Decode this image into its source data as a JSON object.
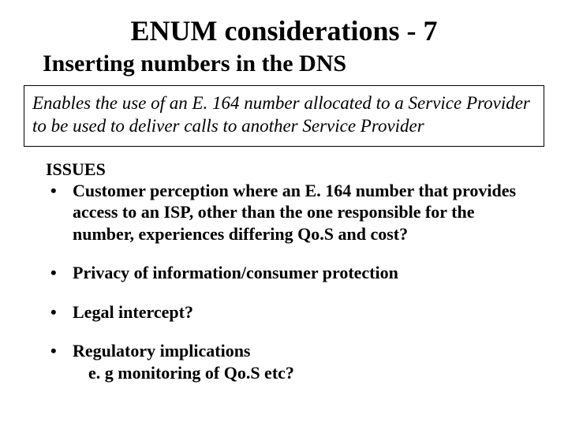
{
  "title": "ENUM considerations - 7",
  "subtitle": "Inserting numbers in the DNS",
  "box_text": "Enables the use of an E. 164 number allocated to a Service Provider to be used to deliver calls to another Service Provider",
  "issues_heading": "ISSUES",
  "bullets": [
    {
      "text": "Customer perception where an E. 164 number that provides access to an ISP, other than the one responsible for the number, experiences differing Qo.S and cost?"
    },
    {
      "text": "Privacy of information/consumer protection"
    },
    {
      "text": "Legal intercept?"
    },
    {
      "text": "Regulatory implications",
      "subtext": "e. g monitoring of Qo.S etc?"
    }
  ]
}
